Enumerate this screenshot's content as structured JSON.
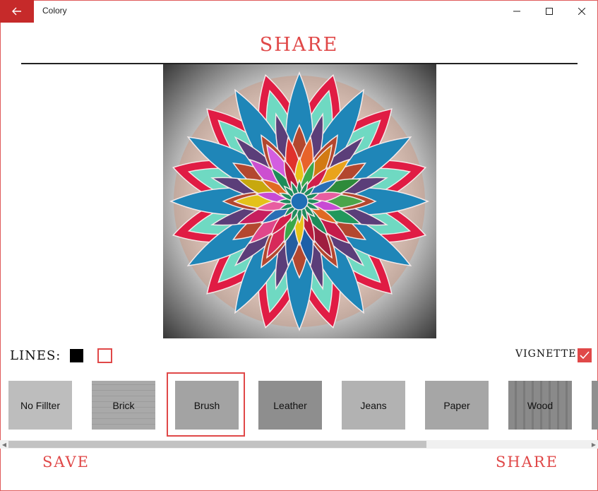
{
  "window": {
    "title": "Colory"
  },
  "page": {
    "heading": "SHARE"
  },
  "options": {
    "lines_label": "LINES:",
    "vignette_label": "VIGNETTE",
    "vignette_checked": true
  },
  "colors": {
    "accent": "#e04848",
    "back_button": "#c62a2a"
  },
  "filters": [
    {
      "label": "No Fillter",
      "selected": false
    },
    {
      "label": "Brick",
      "selected": false
    },
    {
      "label": "Brush",
      "selected": true
    },
    {
      "label": "Leather",
      "selected": false
    },
    {
      "label": "Jeans",
      "selected": false
    },
    {
      "label": "Paper",
      "selected": false
    },
    {
      "label": "Wood",
      "selected": false
    }
  ],
  "actions": {
    "save_label": "SAVE",
    "share_label": "SHARE"
  }
}
